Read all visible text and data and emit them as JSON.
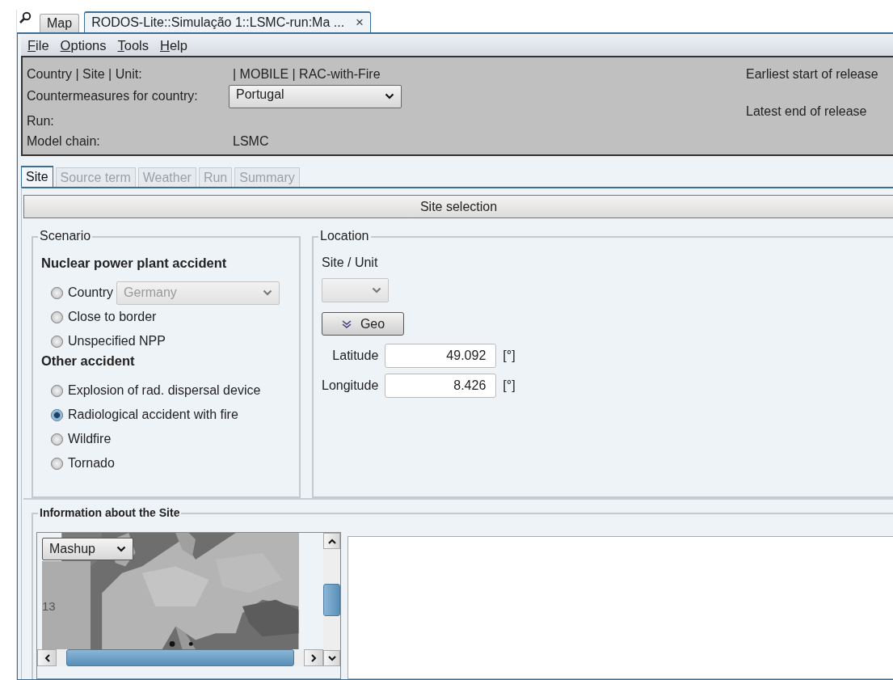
{
  "tabs": [
    {
      "label": "Map",
      "selected": false
    },
    {
      "label": "RODOS-Lite::Simulação 1::LSMC-run:Ma ...",
      "selected": true,
      "close": "×"
    }
  ],
  "menu": [
    {
      "key": "F",
      "rest": "ile"
    },
    {
      "key": "O",
      "rest": "ptions"
    },
    {
      "key": "T",
      "rest": "ools"
    },
    {
      "key": "H",
      "rest": "elp"
    }
  ],
  "header": {
    "fields": [
      {
        "kind": "text",
        "label": "Country | Site | Unit:",
        "value": "| MOBILE | RAC-with-Fire"
      },
      {
        "kind": "dropdown",
        "label": "Countermeasures for country:",
        "value": "Portugal"
      },
      {
        "kind": "text",
        "label": "Run:"
      },
      {
        "kind": "text",
        "label": "Model chain:",
        "value": "LSMC"
      }
    ],
    "release": [
      "Earliest start of release",
      "Latest end of release"
    ]
  },
  "view_tabs": [
    {
      "label": "Site",
      "selected": true,
      "disabled": false
    },
    {
      "label": "Source term",
      "selected": false,
      "disabled": true
    },
    {
      "label": "Weather",
      "selected": false,
      "disabled": true
    },
    {
      "label": "Run",
      "selected": false,
      "disabled": true
    },
    {
      "label": "Summary",
      "selected": false,
      "disabled": true
    }
  ],
  "section_title": "Site selection",
  "scenario": {
    "title": "Scenario",
    "groups": [
      {
        "heading": "Nuclear power plant accident",
        "options": [
          {
            "label": "Country",
            "selected": false,
            "dropdown": {
              "value": "Germany",
              "disabled": true
            }
          },
          {
            "label": "Close to border",
            "selected": false
          },
          {
            "label": "Unspecified NPP",
            "selected": false
          }
        ]
      },
      {
        "heading": "Other accident",
        "options": [
          {
            "label": "Explosion of rad. dispersal device",
            "selected": false
          },
          {
            "label": "Radiological accident with fire",
            "selected": true
          },
          {
            "label": "Wildfire",
            "selected": false
          },
          {
            "label": "Tornado",
            "selected": false
          }
        ]
      }
    ]
  },
  "location": {
    "title": "Location",
    "site_unit_label": "Site / Unit",
    "geo_button": "Geo",
    "coords": [
      {
        "label": "Latitude",
        "value": "49.092",
        "unit": "[°]"
      },
      {
        "label": "Longitude",
        "value": "8.426",
        "unit": "[°]"
      }
    ]
  },
  "site_info": {
    "title": "Information about the Site",
    "map_layer": "Mashup",
    "zoom_label": "13"
  }
}
